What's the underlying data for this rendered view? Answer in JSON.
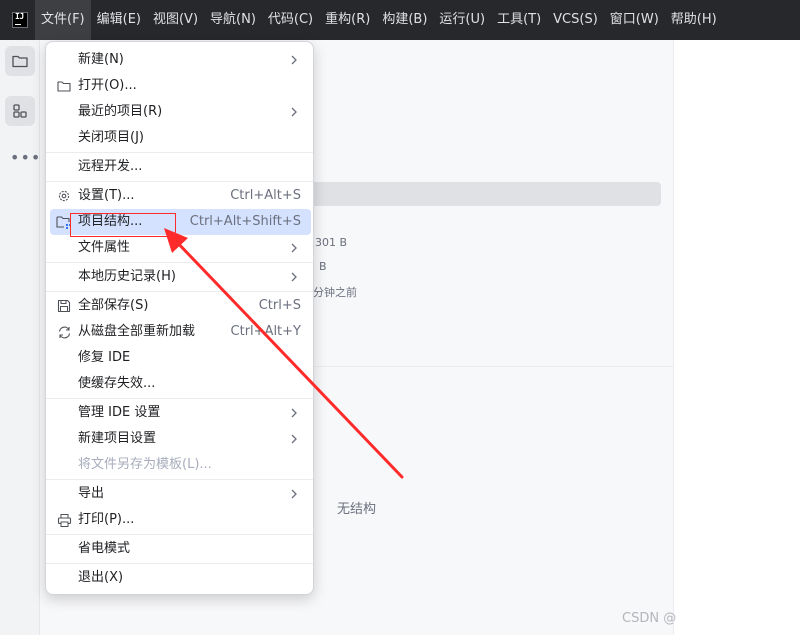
{
  "menubar": {
    "items": [
      {
        "label": "文件(F)",
        "active": true
      },
      {
        "label": "编辑(E)"
      },
      {
        "label": "视图(V)"
      },
      {
        "label": "导航(N)"
      },
      {
        "label": "代码(C)"
      },
      {
        "label": "重构(R)"
      },
      {
        "label": "构建(B)"
      },
      {
        "label": "运行(U)"
      },
      {
        "label": "工具(T)"
      },
      {
        "label": "VCS(S)"
      },
      {
        "label": "窗口(W)"
      },
      {
        "label": "帮助(H)"
      }
    ]
  },
  "file_menu": {
    "new_label": "新建(N)",
    "open_label": "打开(O)...",
    "recent_label": "最近的项目(R)",
    "close_label": "关闭项目(J)",
    "remote_label": "远程开发...",
    "settings_label": "设置(T)...",
    "settings_shortcut": "Ctrl+Alt+S",
    "structure_label": "项目结构...",
    "structure_shortcut": "Ctrl+Alt+Shift+S",
    "properties_label": "文件属性",
    "history_label": "本地历史记录(H)",
    "save_all_label": "全部保存(S)",
    "save_all_shortcut": "Ctrl+S",
    "reload_label": "从磁盘全部重新加载",
    "reload_shortcut": "Ctrl+Alt+Y",
    "repair_label": "修复 IDE",
    "invalidate_label": "使缓存失效...",
    "manage_ide_label": "管理 IDE 设置",
    "new_project_settings_label": "新建项目设置",
    "save_template_label": "将文件另存为模板(L)...",
    "export_label": "导出",
    "print_label": "打印(P)...",
    "power_save_label": "省电模式",
    "exit_label": "退出(X)"
  },
  "background": {
    "size_1": "301 B",
    "size_2": "B",
    "time_ago": "分钟之前",
    "no_structure": "无结构",
    "watermark": "CSDN @"
  },
  "colors": {
    "menubar_bg": "#27282c",
    "highlight_bg": "#d4e2ff",
    "annotation_red": "#ff2a2a"
  }
}
